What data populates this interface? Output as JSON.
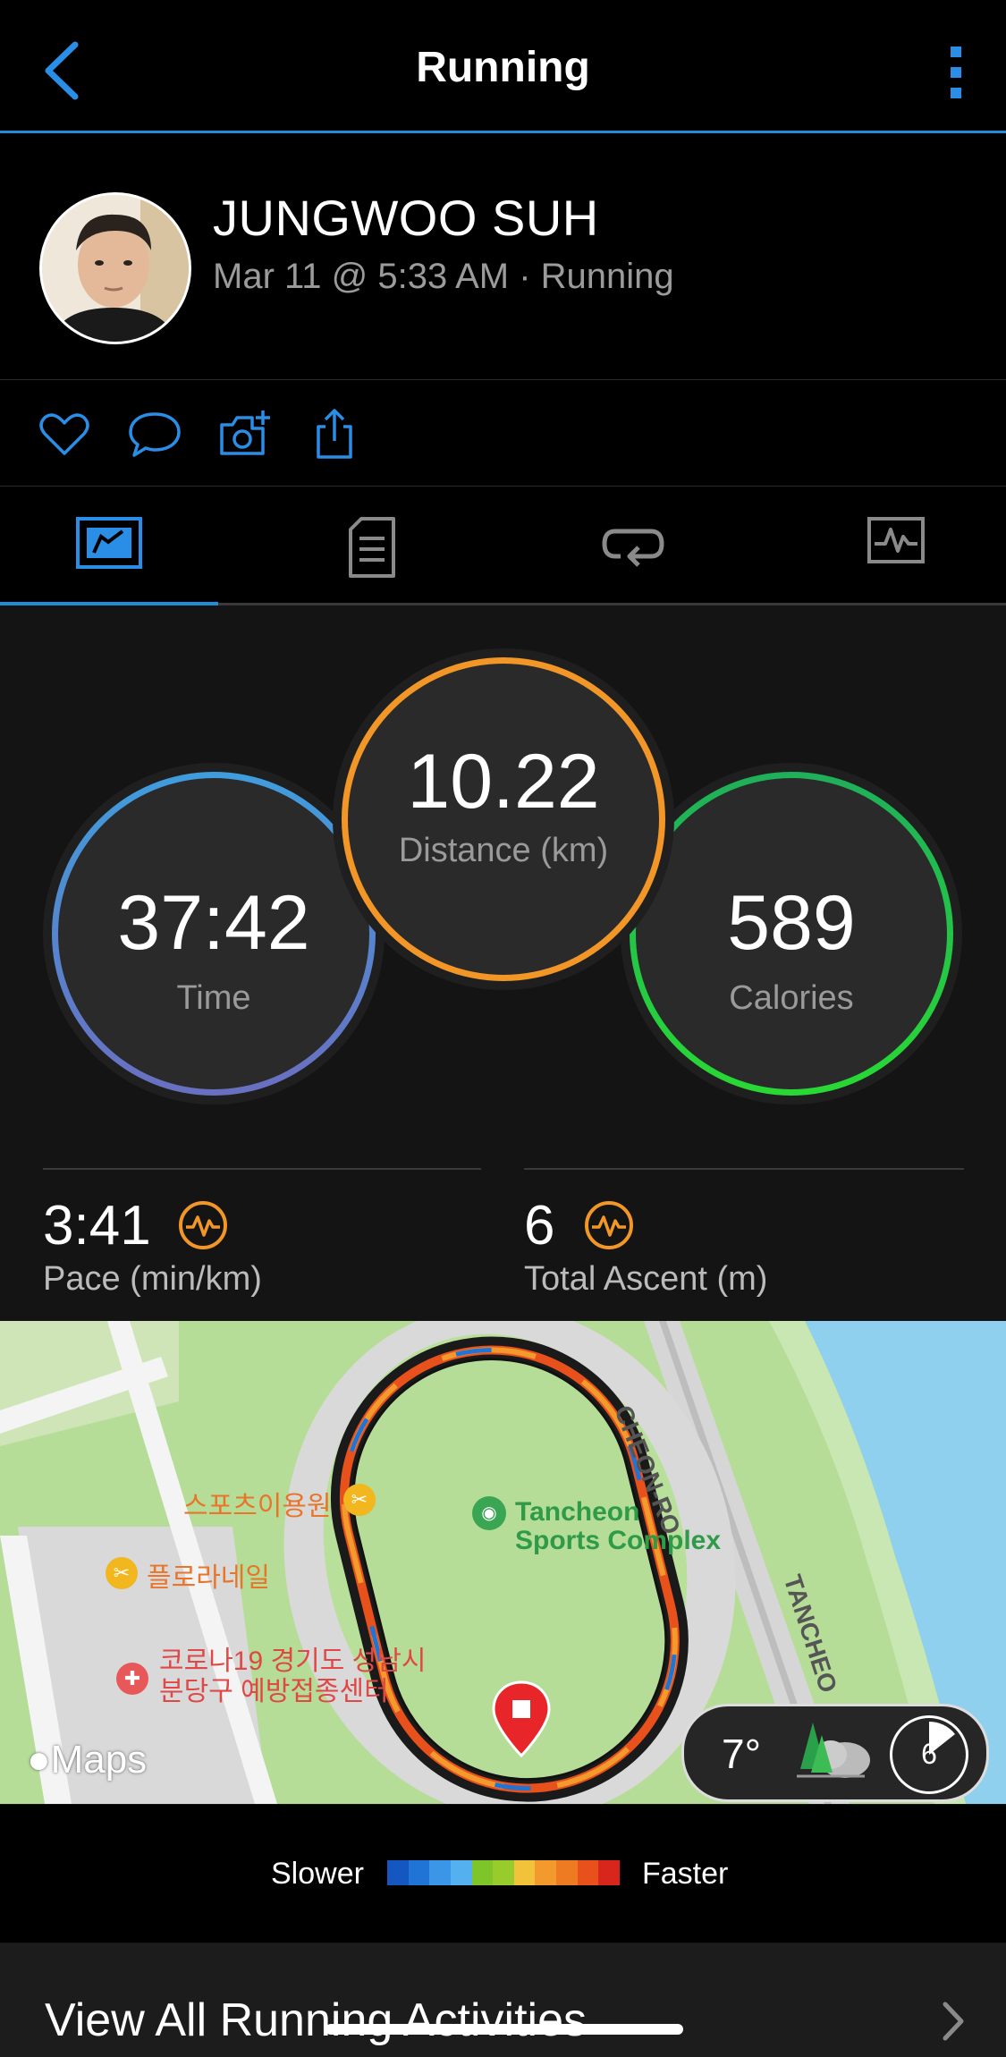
{
  "header": {
    "title": "Running"
  },
  "profile": {
    "name": "JUNGWOO SUH",
    "subtitle": "Mar 11 @ 5:33 AM · Running"
  },
  "actions": {
    "icons": [
      "heart-icon",
      "comment-icon",
      "add-photo-icon",
      "share-icon"
    ]
  },
  "tabs": {
    "selected_index": 0,
    "icons": [
      "overview-icon",
      "details-icon",
      "laps-icon",
      "charts-icon"
    ]
  },
  "stats": {
    "time": {
      "value": "37:42",
      "label": "Time"
    },
    "distance": {
      "value": "10.22",
      "label": "Distance (km)"
    },
    "calories": {
      "value": "589",
      "label": "Calories"
    },
    "pace": {
      "value": "3:41",
      "label": "Pace (min/km)"
    },
    "ascent": {
      "value": "6",
      "label": "Total Ascent (m)"
    }
  },
  "map": {
    "poi_1": "스포츠이용원",
    "poi_2": "플로라네일",
    "poi_3_line1": "코로나19 경기도 성남시",
    "poi_3_line2": "분당구 예방접종센터",
    "complex_line1": "Tancheon",
    "complex_line2": "Sports Complex",
    "road_1": "CHEON-RO",
    "road_2": "TANCHEO",
    "attribution": "Maps",
    "weather": {
      "temperature": "7°",
      "wind": "6"
    }
  },
  "legend": {
    "slower_label": "Slower",
    "faster_label": "Faster",
    "colors": [
      "#1557c0",
      "#1f74d6",
      "#3c96e8",
      "#55b0f0",
      "#7ec52a",
      "#98cc2c",
      "#f2c23a",
      "#f39a2c",
      "#ee7a22",
      "#e8501c",
      "#d9261c"
    ]
  },
  "footer": {
    "view_all": "View All Running Activities"
  },
  "colors": {
    "accent": "#1f8ed8",
    "time_ring": "#3f9ddd",
    "distance_ring": "#f29727",
    "calories_ring": "#22c43f"
  }
}
